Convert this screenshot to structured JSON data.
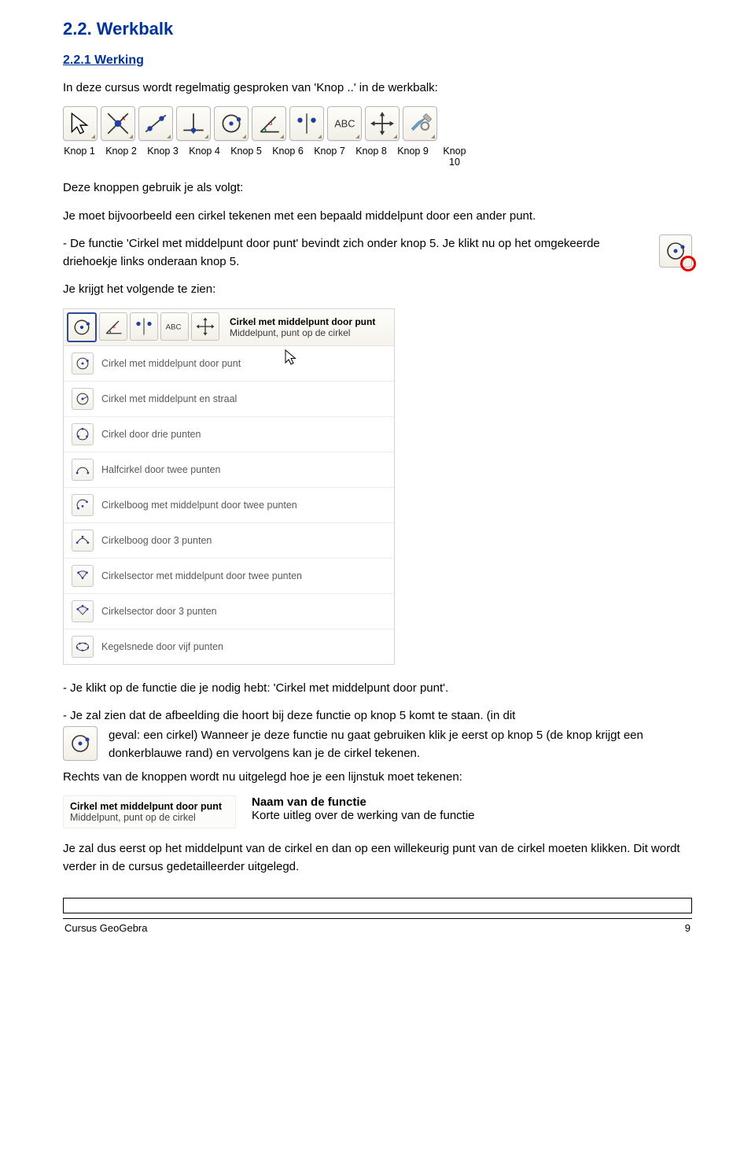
{
  "section_title": "2.2. Werkbalk",
  "subsection_title": "2.2.1 Werking",
  "p1": "In deze cursus wordt regelmatig gesproken van 'Knop ..' in de werkbalk:",
  "knop_labels": [
    "Knop 1",
    "Knop 2",
    "Knop 3",
    "Knop 4",
    "Knop 5",
    "Knop 6",
    "Knop 7",
    "Knop 8",
    "Knop 9",
    "Knop 10"
  ],
  "p2": "Deze knoppen gebruik je als volgt:",
  "p3": "Je moet bijvoorbeeld een cirkel tekenen met een bepaald middelpunt door een ander punt.",
  "p4": "- De functie 'Cirkel met middelpunt door punt' bevindt zich onder knop 5. Je klikt nu op het omgekeerde driehoekje links onderaan knop 5.",
  "p5": "Je krijgt het volgende te zien:",
  "menu_top_tip_bold": "Cirkel met middelpunt door punt",
  "menu_top_tip_sub": "Middelpunt, punt op de cirkel",
  "menu_items": [
    "Cirkel met middelpunt door punt",
    "Cirkel met middelpunt en straal",
    "Cirkel door drie punten",
    "Halfcirkel door twee punten",
    "Cirkelboog met middelpunt door twee punten",
    "Cirkelboog door 3 punten",
    "Cirkelsector met middelpunt door twee punten",
    "Cirkelsector door 3 punten",
    "Kegelsnede door vijf punten"
  ],
  "p6": "- Je klikt op de functie die je nodig hebt: 'Cirkel met middelpunt door punt'.",
  "p7a": "- Je zal zien dat de afbeelding die hoort bij deze functie op knop 5 komt te staan. (in dit",
  "p7b": "geval: een cirkel) Wanneer je deze functie nu gaat gebruiken klik je eerst op knop 5 (de knop krijgt een donkerblauwe rand) en vervolgens kan je de cirkel tekenen.",
  "p8": "Rechts van de knoppen wordt nu uitgelegd hoe je een lijnstuk moet tekenen:",
  "tooltip_visual_bold": "Cirkel met middelpunt door punt",
  "tooltip_visual_sub": "Middelpunt, punt op de cirkel",
  "tooltip_desc_bold": "Naam van de functie",
  "tooltip_desc_sub": "Korte uitleg over de werking van de functie",
  "p9": "Je zal dus eerst op het middelpunt van de cirkel en dan op een willekeurig punt van de cirkel moeten klikken. Dit wordt verder in de cursus gedetailleerder uitgelegd.",
  "footer_left": "Cursus GeoGebra",
  "footer_right": "9",
  "menu_small_abc": "ABC"
}
